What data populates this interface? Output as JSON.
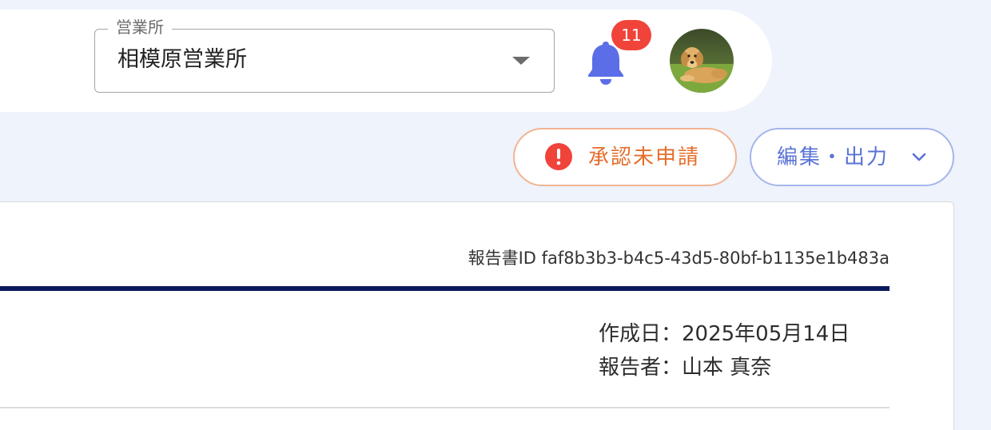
{
  "header": {
    "office_select": {
      "label": "営業所",
      "value": "相模原営業所"
    },
    "notifications": {
      "icon": "bell-icon",
      "count": "11",
      "color": "#5b6ee8",
      "badge_color": "#f0433a"
    },
    "avatar": {
      "icon": "avatar-golden-retriever"
    }
  },
  "actions": {
    "approval_status_label": "承認未申請",
    "approval_status_icon": "exclamation-circle-icon",
    "approval_status_color": "#e46d2a",
    "edit_output_label": "編集・出力",
    "edit_output_icon": "chevron-down-icon",
    "edit_output_color": "#5a73d6"
  },
  "report": {
    "id_label": "報告書ID",
    "id_value": "faf8b3b3-b4c5-43d5-80bf-b1135e1b483a",
    "created_line": "作成日：2025年05月14日",
    "reporter_line": "報告者：山本 真奈",
    "accent_color": "#0b1a5c"
  }
}
